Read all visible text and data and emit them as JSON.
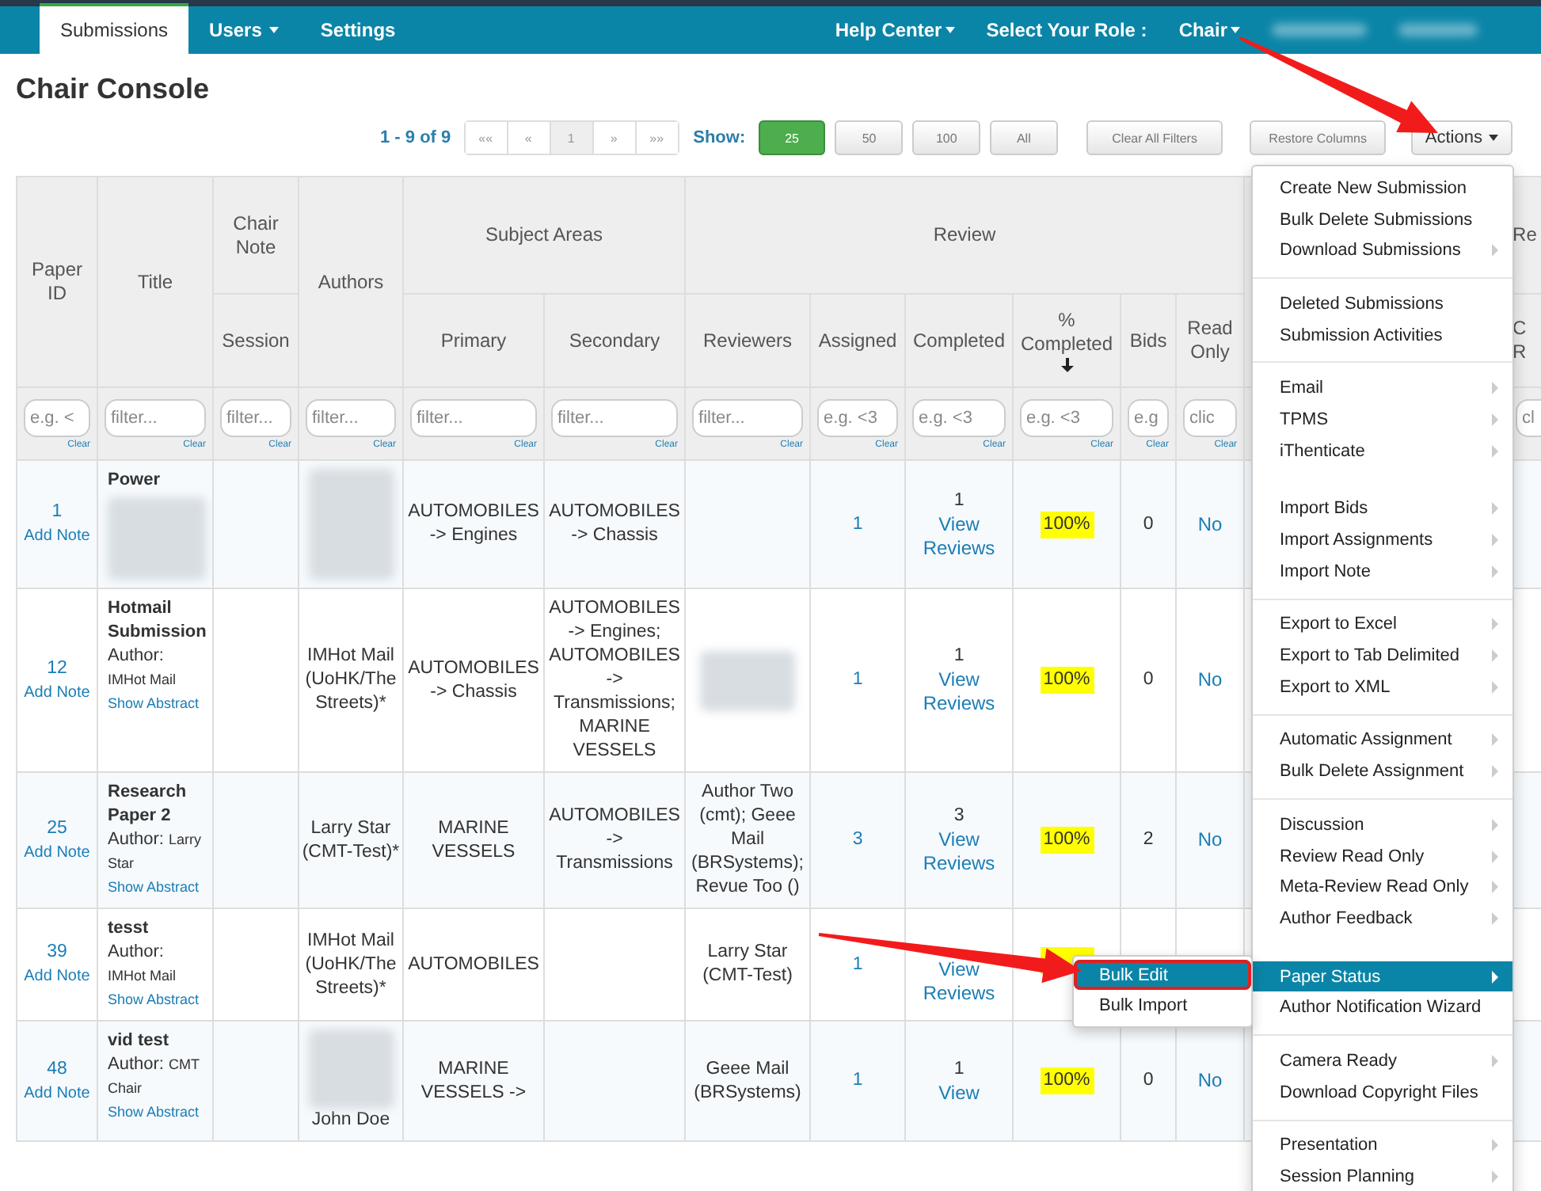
{
  "nav": {
    "tabs": [
      {
        "label": "Submissions",
        "selected": true,
        "dropdown": false
      },
      {
        "label": "Users",
        "selected": false,
        "dropdown": true
      },
      {
        "label": "Settings",
        "selected": false,
        "dropdown": false
      }
    ],
    "right": [
      {
        "label": "Help Center",
        "dropdown": true
      },
      {
        "label": "Select Your Role :",
        "dropdown": false
      },
      {
        "label": "Chair",
        "dropdown": true
      }
    ],
    "account_items": [
      {
        "kind": "redacted"
      },
      {
        "kind": "redacted"
      }
    ]
  },
  "page_title": "Chair Console",
  "pager": {
    "range": "1 - 9 of 9",
    "pages": [
      {
        "label": "««",
        "selected": false
      },
      {
        "label": "«",
        "selected": false
      },
      {
        "label": "1",
        "selected": true
      },
      {
        "label": "»",
        "selected": false
      },
      {
        "label": "»»",
        "selected": false
      }
    ],
    "show_label": "Show:",
    "sizes": [
      {
        "label": "25",
        "selected": true
      },
      {
        "label": "50",
        "selected": false
      },
      {
        "label": "100",
        "selected": false
      },
      {
        "label": "All",
        "selected": false
      }
    ],
    "buttons": [
      "Clear All Filters",
      "Restore Columns"
    ],
    "actions": "Actions"
  },
  "table": {
    "headers": [
      {
        "label": "Paper ID"
      },
      {
        "label": "Title"
      },
      {
        "label": "Chair Note",
        "sub": [
          {
            "label": "Session",
            "sorted": false
          }
        ]
      },
      {
        "label": "Authors"
      },
      {
        "label": "Subject Areas",
        "sub": [
          {
            "label": "Primary",
            "sorted": false
          },
          {
            "label": "Secondary",
            "sorted": false
          }
        ]
      },
      {
        "label": "Review",
        "sub": [
          {
            "label": "Reviewers",
            "sorted": false
          },
          {
            "label": "Assigned",
            "sorted": false
          },
          {
            "label": "Completed",
            "sorted": false
          },
          {
            "label": "% Completed",
            "sorted": true
          },
          {
            "label": "Bids",
            "sorted": false
          },
          {
            "label": "Read Only",
            "sorted": false
          }
        ]
      },
      {
        "label": "Re",
        "sub": [
          {
            "label": "C R",
            "sorted": false
          }
        ]
      }
    ],
    "filters": [
      {
        "placeholder": "e.g. <",
        "clear": "Clear"
      },
      {
        "placeholder": "filter...",
        "clear": "Clear"
      },
      {
        "placeholder": "filter...",
        "clear": "Clear"
      },
      {
        "placeholder": "filter...",
        "clear": "Clear"
      },
      {
        "placeholder": "filter...",
        "clear": "Clear"
      },
      {
        "placeholder": "filter...",
        "clear": "Clear"
      },
      {
        "placeholder": "filter...",
        "clear": "Clear"
      },
      {
        "placeholder": "e.g. <3",
        "clear": "Clear"
      },
      {
        "placeholder": "e.g. <3",
        "clear": "Clear"
      },
      {
        "placeholder": "e.g. <3",
        "clear": "Clear"
      },
      {
        "placeholder": "e.g",
        "clear": "Clear"
      },
      {
        "placeholder": "clic",
        "clear": "Clear"
      },
      {
        "placeholder": "cl"
      }
    ],
    "rows": [
      {
        "id": "1",
        "note_link": "Add Note",
        "title": "Power",
        "title_redacted": true,
        "authors_redacted": true,
        "primary": "AUTOMOBILES -> Engines",
        "secondary": "AUTOMOBILES -> Chassis",
        "assigned": "1",
        "completed": "1",
        "view_link": "View Reviews",
        "percent": "100%",
        "highlight": true,
        "bids": "0",
        "read_only": "No"
      },
      {
        "id": "12",
        "note_link": "Add Note",
        "title": "Hotmail Submission",
        "author_label": "Author:",
        "author": "IMHot Mail",
        "abstract_link": "Show Abstract",
        "authors": "IMHot Mail (UoHK/The Streets)*",
        "primary": "AUTOMOBILES -> Chassis",
        "secondary": "AUTOMOBILES -> Engines; AUTOMOBILES -> Transmissions; MARINE VESSELS",
        "reviewers_redacted": true,
        "assigned": "1",
        "completed": "1",
        "view_link": "View Reviews",
        "percent": "100%",
        "highlight": true,
        "bids": "0",
        "read_only": "No"
      },
      {
        "id": "25",
        "note_link": "Add Note",
        "title": "Research Paper 2",
        "author_label": "Author:",
        "author": "Larry Star",
        "abstract_link": "Show Abstract",
        "authors": "Larry Star (CMT-Test)*",
        "primary": "MARINE VESSELS",
        "secondary": "AUTOMOBILES -> Transmissions",
        "reviewers": "Author Two (cmt); Geee Mail (BRSystems); Revue Too ()",
        "assigned": "3",
        "completed": "3",
        "view_link": "View Reviews",
        "percent": "100%",
        "highlight": true,
        "bids": "2",
        "read_only": "No"
      },
      {
        "id": "39",
        "note_link": "Add Note",
        "title": "tesst",
        "author_label": "Author:",
        "author": "IMHot Mail",
        "abstract_link": "Show Abstract",
        "authors": "IMHot Mail (UoHK/The Streets)*",
        "primary": "AUTOMOBILES",
        "reviewers": "Larry Star (CMT-Test)",
        "assigned": "1",
        "view_link": "View Reviews",
        "highlight": true
      },
      {
        "id": "48",
        "note_link": "Add Note",
        "title": "vid test",
        "author_label": "Author:",
        "author": "CMT Chair",
        "abstract_link": "Show Abstract",
        "authors_redacted": true,
        "authors": "John Doe",
        "primary": "MARINE VESSELS ->",
        "reviewers": "Geee Mail (BRSystems)",
        "assigned": "1",
        "completed": "1",
        "view_link": "View",
        "percent": "100%",
        "highlight": true,
        "bids": "0",
        "read_only": "No"
      }
    ]
  },
  "actions_menu": [
    {
      "divider": false,
      "items": [
        {
          "label": "Create New Submission",
          "submenu": false,
          "selected": false
        },
        {
          "label": "Bulk Delete Submissions",
          "submenu": false,
          "selected": false
        },
        {
          "label": "Download Submissions",
          "submenu": true,
          "selected": false
        }
      ]
    },
    {
      "divider": true,
      "items": [
        {
          "label": "Deleted Submissions",
          "submenu": false,
          "selected": false
        },
        {
          "label": "Submission Activities",
          "submenu": false,
          "selected": false
        }
      ]
    },
    {
      "divider": true,
      "items": [
        {
          "label": "Email",
          "submenu": true,
          "selected": false
        },
        {
          "label": "TPMS",
          "submenu": true,
          "selected": false
        },
        {
          "label": "iThenticate",
          "submenu": true,
          "selected": false
        }
      ]
    },
    {
      "divider": false,
      "items": [
        {
          "label": "Import Bids",
          "submenu": true,
          "selected": false
        },
        {
          "label": "Import Assignments",
          "submenu": true,
          "selected": false
        },
        {
          "label": "Import Note",
          "submenu": true,
          "selected": false
        }
      ]
    },
    {
      "divider": true,
      "items": [
        {
          "label": "Export to Excel",
          "submenu": true,
          "selected": false
        },
        {
          "label": "Export to Tab Delimited",
          "submenu": true,
          "selected": false
        },
        {
          "label": "Export to XML",
          "submenu": true,
          "selected": false
        }
      ]
    },
    {
      "divider": true,
      "items": [
        {
          "label": "Automatic Assignment",
          "submenu": true,
          "selected": false
        },
        {
          "label": "Bulk Delete Assignment",
          "submenu": true,
          "selected": false
        }
      ]
    },
    {
      "divider": true,
      "items": [
        {
          "label": "Discussion",
          "submenu": true,
          "selected": false
        },
        {
          "label": "Review Read Only",
          "submenu": true,
          "selected": false
        },
        {
          "label": "Meta-Review Read Only",
          "submenu": true,
          "selected": false
        },
        {
          "label": "Author Feedback",
          "submenu": true,
          "selected": false
        }
      ]
    },
    {
      "divider": false,
      "items": [
        {
          "label": "Paper Status",
          "submenu": true,
          "selected": true
        },
        {
          "label": "Author Notification Wizard",
          "submenu": false,
          "selected": false
        }
      ]
    },
    {
      "divider": true,
      "items": [
        {
          "label": "Camera Ready",
          "submenu": true,
          "selected": false
        },
        {
          "label": "Download Copyright Files",
          "submenu": false,
          "selected": false
        }
      ]
    },
    {
      "divider": true,
      "items": [
        {
          "label": "Presentation",
          "submenu": true,
          "selected": false
        },
        {
          "label": "Session Planning",
          "submenu": true,
          "selected": false
        }
      ]
    }
  ],
  "submenu": [
    {
      "label": "Bulk Edit",
      "selected": true,
      "outlined": true
    },
    {
      "label": "Bulk Import",
      "selected": false,
      "outlined": false
    }
  ]
}
